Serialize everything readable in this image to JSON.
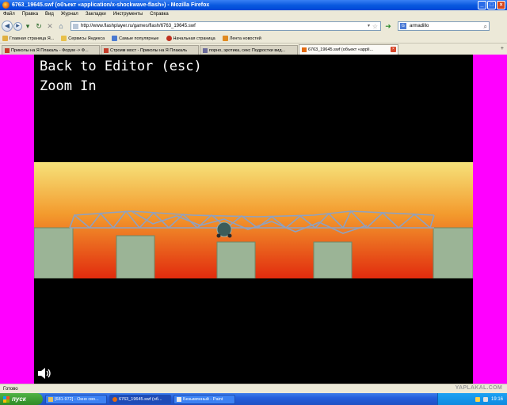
{
  "window": {
    "title": "6763_19645.swf (объект «application/x-shockwave-flash») - Mozilla Firefox",
    "controls": [
      "_",
      "□",
      "×"
    ]
  },
  "menu": [
    "Файл",
    "Правка",
    "Вид",
    "Журнал",
    "Закладки",
    "Инструменты",
    "Справка"
  ],
  "nav": {
    "back_icon": "◀",
    "forward_icon": "▶",
    "dropdown_icon": "▾",
    "reload_icon": "↻",
    "stop_icon": "✕",
    "home_icon": "⌂",
    "url": "http://www.flashplayer.ru/games/flash/6763_19645.swf",
    "url_drop_icon": "▾",
    "star_icon": "☆",
    "go_icon": "➜",
    "search_engine_icon": "G",
    "search_value": "armadillo",
    "search_icon": "⌕"
  },
  "bookmarks": [
    {
      "label": "Главная страница Я...",
      "icon_color": "#e0b040"
    },
    {
      "label": "Сервисы Яндекса",
      "icon_color": "#e8c04a"
    },
    {
      "label": "Самые популярные",
      "icon_color": "#4a7ad0"
    },
    {
      "label": "Начальная страница",
      "icon_color": "#c03020"
    },
    {
      "label": "Лента новостей",
      "icon_color": "#e08a20"
    }
  ],
  "tabs": [
    {
      "label": "Приколы на Я Плакаль - Форум -> Ф...",
      "active": false
    },
    {
      "label": "Строим мост - Приколы на Я Плакаль",
      "active": false
    },
    {
      "label": "порно, эротика, секс Подростки вид...",
      "active": false
    },
    {
      "label": "6763_19645.swf (объект «appli...",
      "active": true
    }
  ],
  "tab_close_icon": "×",
  "tab_new_icon": "+",
  "flash": {
    "back_to_editor": "Back to Editor (esc)",
    "zoom_in": "Zoom In",
    "sound_icon": "speaker-icon",
    "sky_top_color": "#f6e27a",
    "sky_bottom_color": "#e12b0e",
    "pillar_color": "#9bb496",
    "truss_color": "#8fa1c0"
  },
  "status": "Готово",
  "taskbar": {
    "start_label": "пуск",
    "items": [
      {
        "label": "[681-972] - Окно сво...",
        "active": false,
        "icon_color": "#e3c060"
      },
      {
        "label": "6763_19645.swf (об...",
        "active": true,
        "icon_color": "#e36a0f"
      },
      {
        "label": "Безымянный - Paint",
        "active": false,
        "icon_color": "#e8e8e8"
      }
    ],
    "clock": "19:16"
  },
  "watermark": "YAPLAKAL.COM"
}
